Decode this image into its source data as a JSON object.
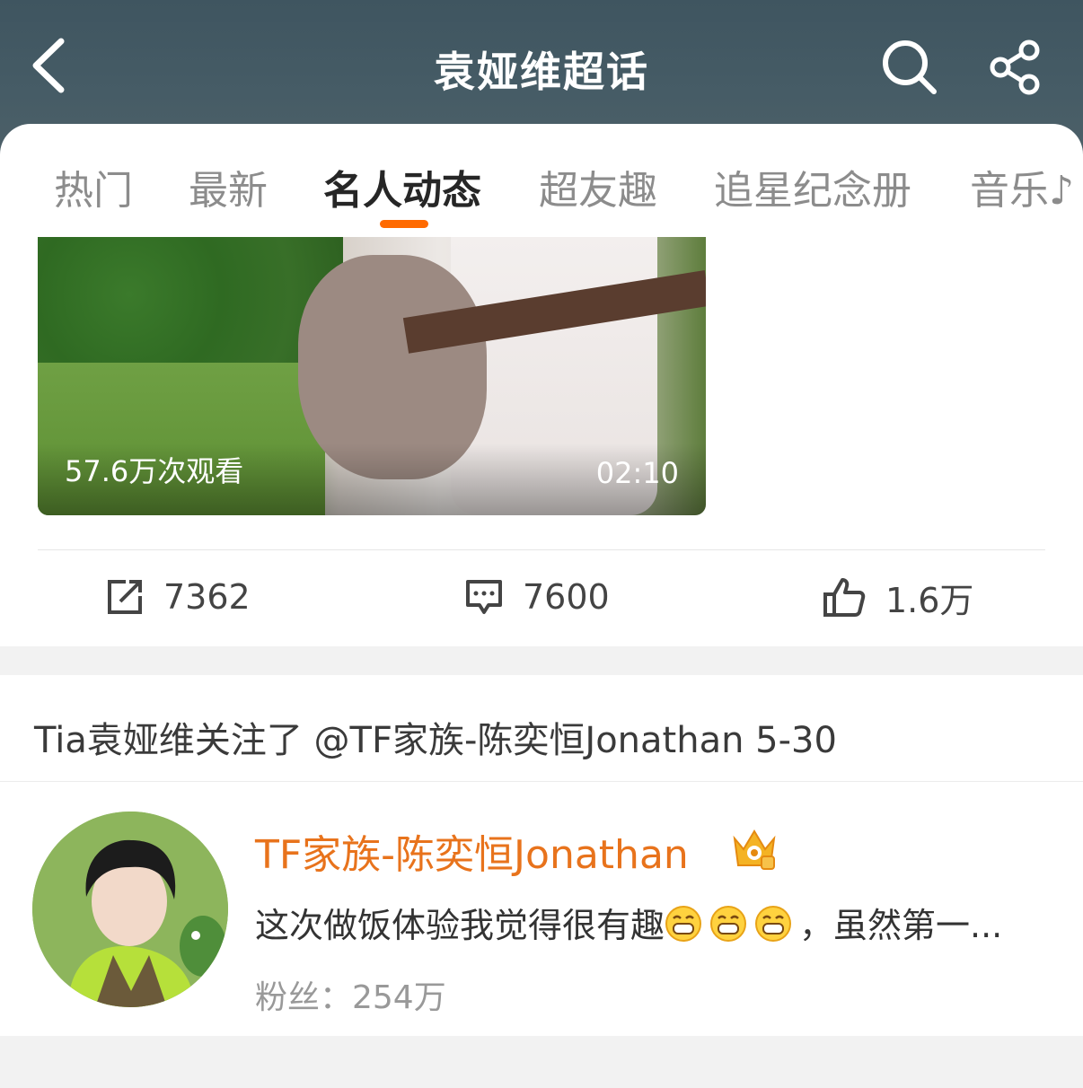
{
  "header": {
    "title": "袁娅维超话",
    "back_icon": "back-arrow-icon",
    "search_icon": "search-icon",
    "share_icon": "share-icon"
  },
  "tabs": [
    {
      "label": "热门",
      "active": false
    },
    {
      "label": "最新",
      "active": false
    },
    {
      "label": "名人动态",
      "active": true
    },
    {
      "label": "超友趣",
      "active": false
    },
    {
      "label": "追星纪念册",
      "active": false
    },
    {
      "label": "音乐♪",
      "active": false
    }
  ],
  "post": {
    "video": {
      "views": "57.6万次观看",
      "duration": "02:10"
    },
    "actions": {
      "repost": "7362",
      "comment": "7600",
      "like": "1.6万"
    }
  },
  "follow_card": {
    "headline": "Tia袁娅维关注了 @TF家族-陈奕恒Jonathan 5-30",
    "user": {
      "name": "TF家族-陈奕恒Jonathan",
      "desc_start": "这次做饭体验我觉得很有趣",
      "desc_end": "，虽然第一...",
      "fans": "粉丝：254万"
    }
  },
  "colors": {
    "accent": "#ff6a00",
    "username": "#e8731c",
    "header_bg": "#465c66"
  }
}
